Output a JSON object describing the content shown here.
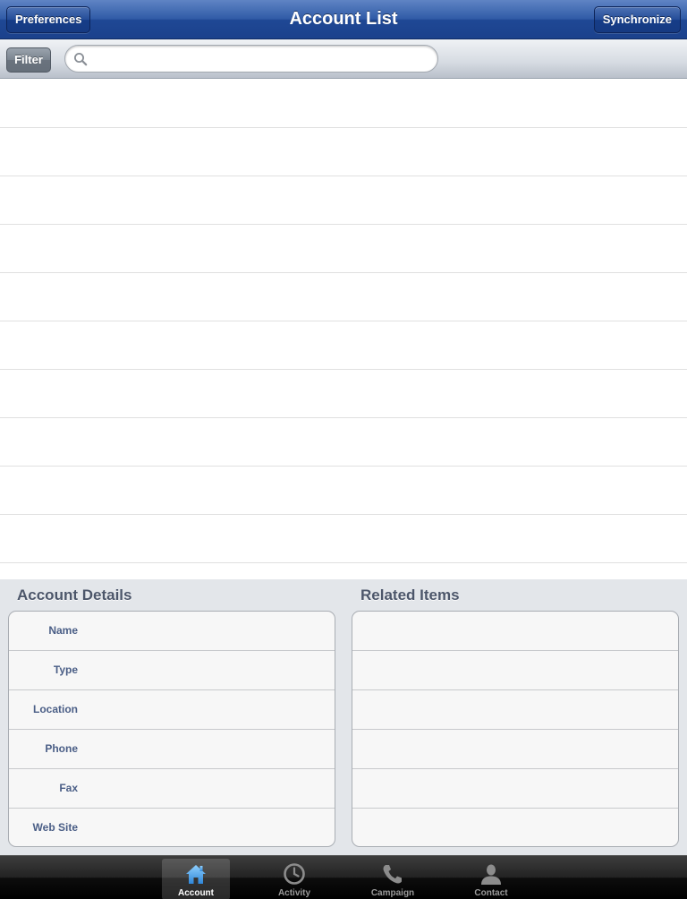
{
  "navbar": {
    "title": "Account List",
    "left_button": "Preferences",
    "right_button": "Synchronize"
  },
  "searchbar": {
    "filter_label": "Filter",
    "search_value": "",
    "search_placeholder": ""
  },
  "list": {
    "rows": [
      "",
      "",
      "",
      "",
      "",
      "",
      "",
      "",
      "",
      "",
      ""
    ]
  },
  "account_details": {
    "title": "Account Details",
    "fields": [
      {
        "label": "Name",
        "value": ""
      },
      {
        "label": "Type",
        "value": ""
      },
      {
        "label": "Location",
        "value": ""
      },
      {
        "label": "Phone",
        "value": ""
      },
      {
        "label": "Fax",
        "value": ""
      },
      {
        "label": "Web Site",
        "value": ""
      }
    ]
  },
  "related_items": {
    "title": "Related Items",
    "items": [
      "",
      "",
      "",
      "",
      "",
      ""
    ]
  },
  "tabbar": {
    "selected": "Account",
    "tabs": [
      {
        "label": "Account",
        "icon": "house-icon"
      },
      {
        "label": "Activity",
        "icon": "clock-icon"
      },
      {
        "label": "Campaign",
        "icon": "phone-icon"
      },
      {
        "label": "Contact",
        "icon": "person-icon"
      }
    ]
  },
  "colors": {
    "navbar_blue": "#2f5aa6",
    "selected_tab_icon": "#4aa3f0",
    "details_background": "#e3e6ea",
    "field_label": "#4a5e86"
  }
}
